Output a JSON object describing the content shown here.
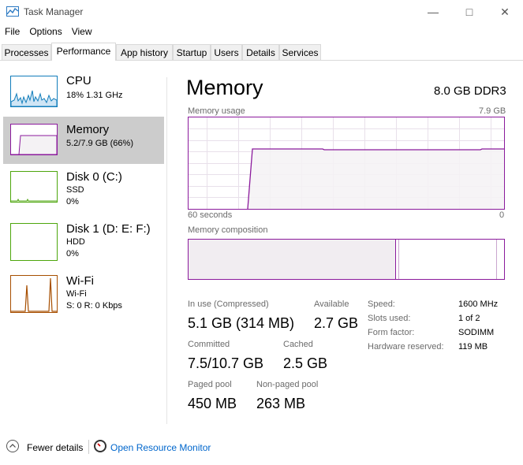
{
  "window": {
    "title": "Task Manager"
  },
  "menu": [
    "File",
    "Options",
    "View"
  ],
  "tabs": [
    "Processes",
    "Performance",
    "App history",
    "Startup",
    "Users",
    "Details",
    "Services"
  ],
  "sidebar": {
    "items": [
      {
        "title": "CPU",
        "line1": "18%  1.31 GHz",
        "line2": ""
      },
      {
        "title": "Memory",
        "line1": "5.2/7.9 GB (66%)",
        "line2": ""
      },
      {
        "title": "Disk 0 (C:)",
        "line1": "SSD",
        "line2": "0%"
      },
      {
        "title": "Disk 1 (D: E: F:)",
        "line1": "HDD",
        "line2": "0%"
      },
      {
        "title": "Wi-Fi",
        "line1": "Wi-Fi",
        "line2": "S: 0  R: 0 Kbps"
      }
    ]
  },
  "memory": {
    "title": "Memory",
    "spec": "8.0 GB DDR3",
    "usage_label": "Memory usage",
    "usage_max": "7.9 GB",
    "time_label": "60 seconds",
    "time_end": "0",
    "composition_label": "Memory composition",
    "stats": {
      "in_use_label": "In use (Compressed)",
      "in_use": "5.1 GB (314 MB)",
      "available_label": "Available",
      "available": "2.7 GB",
      "committed_label": "Committed",
      "committed": "7.5/10.7 GB",
      "cached_label": "Cached",
      "cached": "2.5 GB",
      "paged_label": "Paged pool",
      "paged": "450 MB",
      "nonpaged_label": "Non-paged pool",
      "nonpaged": "263 MB"
    },
    "details": [
      {
        "label": "Speed:",
        "value": "1600 MHz"
      },
      {
        "label": "Slots used:",
        "value": "1 of 2"
      },
      {
        "label": "Form factor:",
        "value": "SODIMM"
      },
      {
        "label": "Hardware reserved:",
        "value": "119 MB"
      }
    ]
  },
  "footer": {
    "fewer_details": "Fewer details",
    "resource_monitor": "Open Resource Monitor"
  },
  "colors": {
    "memory": "#8b1a9c",
    "cpu": "#117dbb",
    "disk": "#4da60c",
    "wifi": "#a74f01",
    "link": "#0066cc"
  }
}
